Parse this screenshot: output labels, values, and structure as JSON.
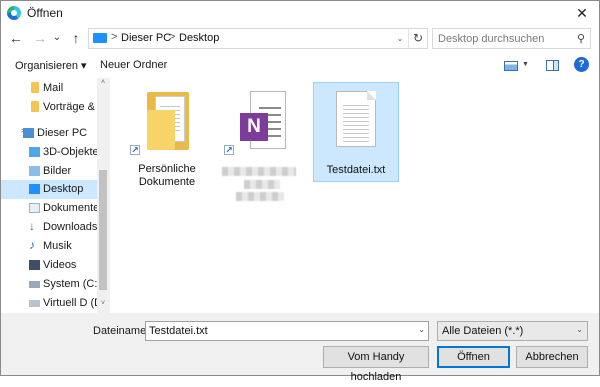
{
  "window": {
    "title": "Öffnen",
    "close_glyph": "✕"
  },
  "nav": {
    "back_glyph": "←",
    "forward_glyph": "→",
    "recent_glyph": "⌄",
    "up_glyph": "↑"
  },
  "address": {
    "crumbs": [
      "Dieser PC",
      "Desktop"
    ],
    "separator": ">",
    "dropdown_glyph": "⌄",
    "refresh_glyph": "↻"
  },
  "search": {
    "placeholder": "Desktop durchsuchen",
    "icon_glyph": "⚲"
  },
  "toolbar": {
    "organize_label": "Organisieren ▾",
    "new_folder_label": "Neuer Ordner",
    "view_arrow": "▼",
    "help_glyph": "?"
  },
  "sidebar": {
    "items": [
      {
        "label": "Mail",
        "icon": "folder-icon"
      },
      {
        "label": "Vorträge & P",
        "icon": "folder-icon"
      },
      {
        "label": "Dieser PC",
        "icon": "computer-icon"
      },
      {
        "label": "3D-Objekte",
        "icon": "3d-objects-icon"
      },
      {
        "label": "Bilder",
        "icon": "pictures-icon"
      },
      {
        "label": "Desktop",
        "icon": "desktop-icon",
        "selected": true
      },
      {
        "label": "Dokumente",
        "icon": "documents-icon"
      },
      {
        "label": "Downloads",
        "icon": "downloads-icon"
      },
      {
        "label": "Musik",
        "icon": "music-icon"
      },
      {
        "label": "Videos",
        "icon": "videos-icon"
      },
      {
        "label": "System (C:)",
        "icon": "drive-icon"
      },
      {
        "label": "Virtuell D (D:",
        "icon": "virtual-drive-icon"
      }
    ],
    "expand_glyph": ">",
    "scroll_up_glyph": "˄",
    "scroll_down_glyph": "˅"
  },
  "icons": {
    "download_glyph": "↓",
    "music_glyph": "♪",
    "onenote_letter": "N",
    "shortcut_glyph": "↗"
  },
  "files": [
    {
      "name_line1": "Persönliche",
      "name_line2": "Dokumente",
      "icon": "folder-shortcut-icon"
    },
    {
      "name_line1": "",
      "name_line2": "",
      "icon": "onenote-shortcut-icon",
      "name_redacted": true
    },
    {
      "name_line1": "Testdatei.txt",
      "name_line2": "",
      "icon": "text-file-icon",
      "selected": true
    }
  ],
  "bottom": {
    "filename_label": "Dateiname:",
    "filename_value": "Testdatei.txt",
    "filetype_value": "Alle Dateien (*.*)",
    "dropdown_glyph": "⌄",
    "upload_button": "Vom Handy hochladen",
    "open_button": "Öffnen",
    "cancel_button": "Abbrechen"
  }
}
